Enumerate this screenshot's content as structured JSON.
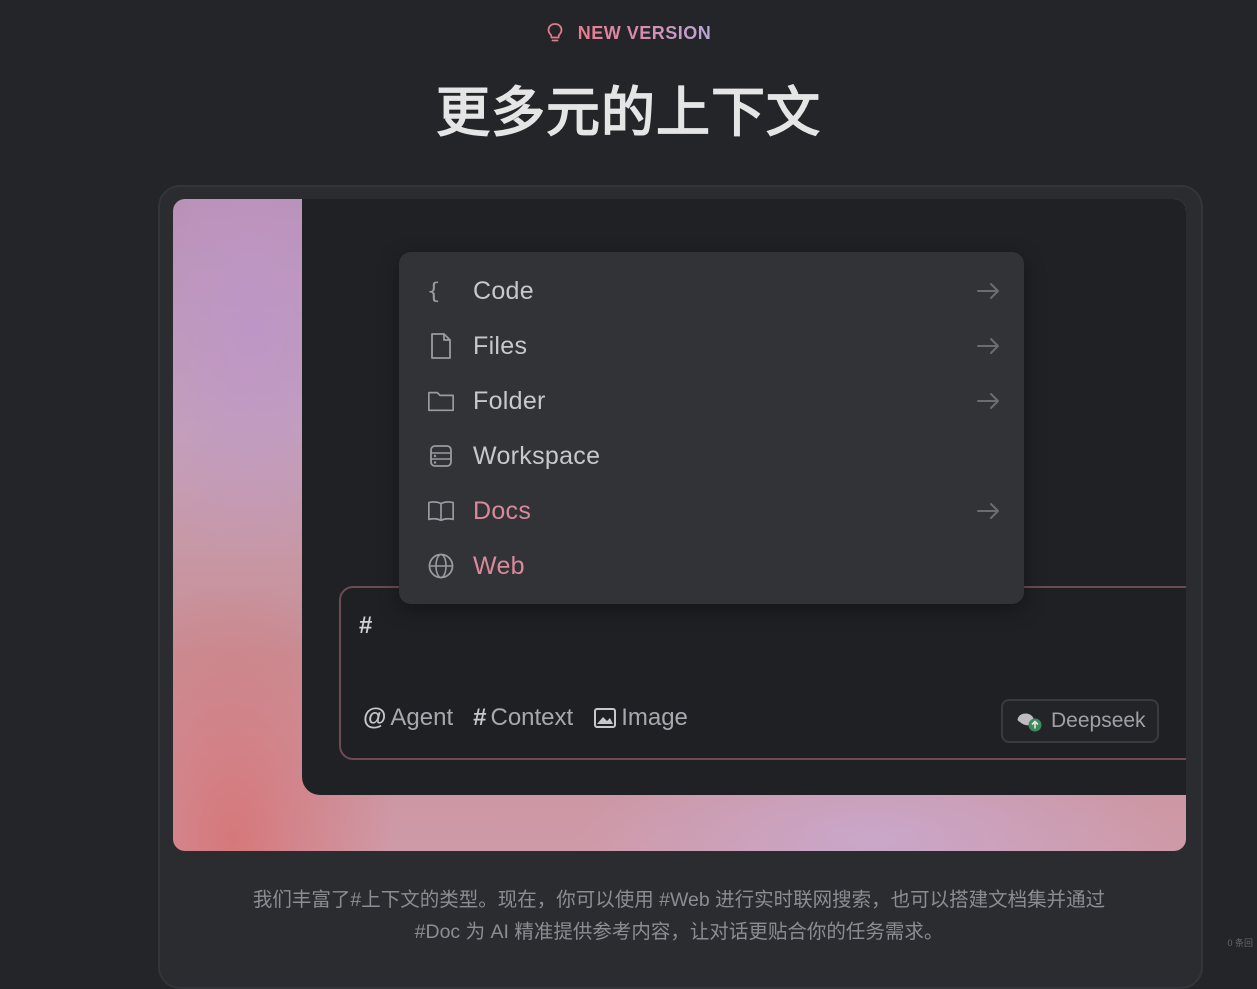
{
  "header": {
    "badge_icon": "lightbulb-icon",
    "badge_text": "NEW VERSION",
    "title": "更多元的上下文"
  },
  "menu": {
    "items": [
      {
        "label": "Code",
        "icon": "braces-icon",
        "has_arrow": true,
        "accent": false
      },
      {
        "label": "Files",
        "icon": "file-icon",
        "has_arrow": true,
        "accent": false
      },
      {
        "label": "Folder",
        "icon": "folder-icon",
        "has_arrow": true,
        "accent": false
      },
      {
        "label": "Workspace",
        "icon": "server-icon",
        "has_arrow": false,
        "accent": false
      },
      {
        "label": "Docs",
        "icon": "book-icon",
        "has_arrow": true,
        "accent": true
      },
      {
        "label": "Web",
        "icon": "globe-icon",
        "has_arrow": false,
        "accent": true
      }
    ]
  },
  "composer": {
    "input_value": "#",
    "tools": [
      {
        "symbol": "@",
        "label": "Agent"
      },
      {
        "symbol": "#",
        "label": "Context"
      },
      {
        "symbol": "image-icon",
        "label": "Image"
      }
    ],
    "model_label": "Deepseek"
  },
  "description": {
    "line1": "我们丰富了#上下文的类型。现在，你可以使用 #Web 进行实时联网搜索，也可以搭建文档集并通过",
    "line2": "#Doc 为 AI 精准提供参考内容，让对话更贴合你的任务需求。"
  },
  "corner_text": "0 条回",
  "colors": {
    "background": "#242528",
    "accent_pink": "#d98a9a",
    "border_accent": "#6e4a52"
  }
}
